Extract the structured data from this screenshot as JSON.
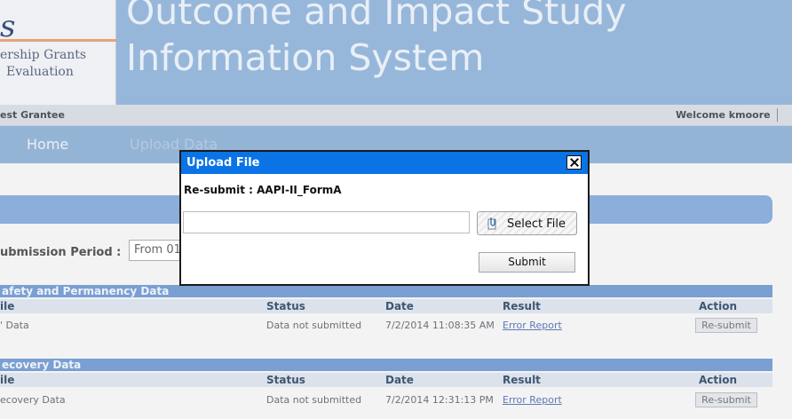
{
  "header": {
    "logo_mark": "s",
    "logo_line1": "ership Grants",
    "logo_line2": "Evaluation",
    "title_line1": "Outcome and Impact Study",
    "title_line2": "Information System"
  },
  "userbar": {
    "grantee": "est Grantee",
    "welcome": "Welcome kmoore"
  },
  "nav": {
    "home": "Home",
    "upload": "Upload Data"
  },
  "filter": {
    "period_label": "ubmission Period :",
    "period_value": "From 01"
  },
  "sections": [
    {
      "title": "afety and Permanency Data",
      "columns": [
        "ile",
        "Status",
        "Date",
        "Result",
        "Action"
      ],
      "row": {
        "title": "' Data",
        "status": "Data not submitted",
        "date": "7/2/2014 11:08:35 AM",
        "result": "Error Report",
        "action": "Re-submit"
      }
    },
    {
      "title": "ecovery Data",
      "columns": [
        "ile",
        "Status",
        "Date",
        "Result",
        "Action"
      ],
      "row": {
        "title": "ecovery Data",
        "status": "Data not submitted",
        "date": "7/2/2014 12:31:13 PM",
        "result": "Error Report",
        "action": "Re-submit"
      }
    }
  ],
  "dialog": {
    "title": "Upload File",
    "subtitle": "Re-submit : AAPI-II_FormA",
    "file_value": "",
    "select_label": "Select File",
    "submit_label": "Submit",
    "close_icon": "close-icon"
  },
  "colors": {
    "header_bg": "#97b7da",
    "dialog_titlebar": "#0a73e6",
    "section_bar": "#7a9fd2",
    "link": "#5d79b6"
  }
}
